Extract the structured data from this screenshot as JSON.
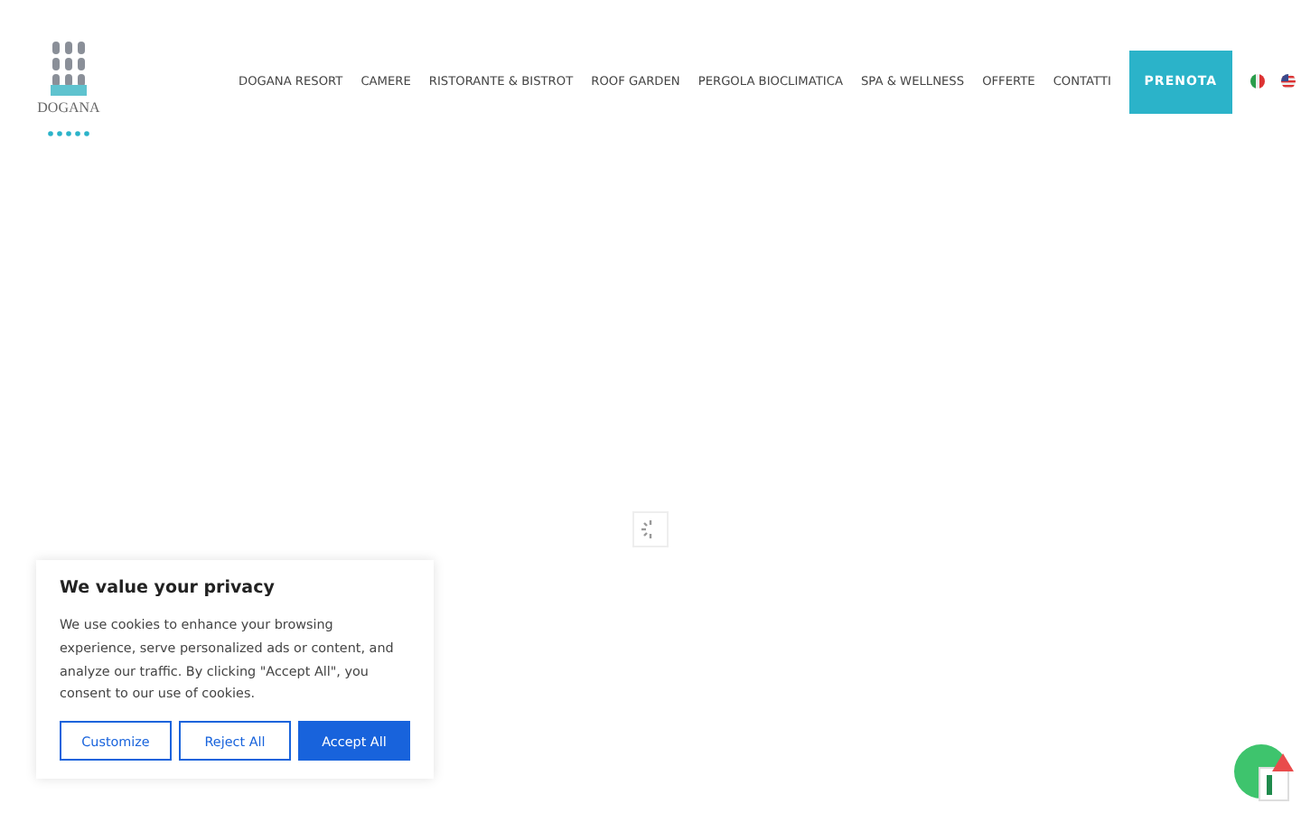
{
  "logo": {
    "text": "DOGANA"
  },
  "nav": {
    "items": [
      "DOGANA RESORT",
      "CAMERE",
      "RISTORANTE & BISTROT",
      "ROOF GARDEN",
      "PERGOLA BIOCLIMATICA",
      "SPA & WELLNESS",
      "OFFERTE",
      "CONTATTI"
    ],
    "cta": "PRENOTA"
  },
  "cookie_banner": {
    "title": "We value your privacy",
    "text": "We use cookies to enhance your browsing experience, serve personalized ads or content, and analyze our traffic. By clicking \"Accept All\", you consent to our use of cookies.",
    "buttons": [
      {
        "label": "Customize",
        "kind": "outline"
      },
      {
        "label": "Reject All",
        "kind": "outline"
      },
      {
        "label": "Accept All",
        "kind": "primary"
      }
    ]
  }
}
